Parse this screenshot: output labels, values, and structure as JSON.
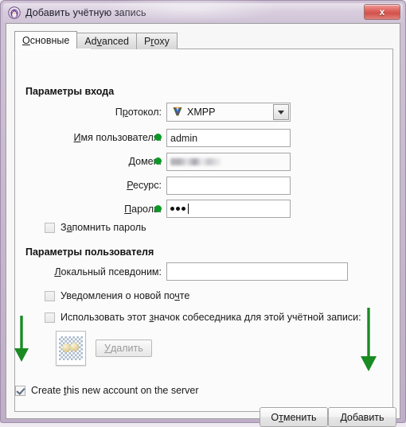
{
  "window": {
    "title": "Добавить учётную запись",
    "icon": "penguin-app-icon",
    "close_label": "x",
    "titlebar_color": "#c7b6cf",
    "close_color": "#d2524c"
  },
  "tabs": [
    {
      "id": "general",
      "label_pre": "",
      "label_mnemonic": "О",
      "label_post": "сновные",
      "active": true
    },
    {
      "id": "advanced",
      "label_pre": "Ad",
      "label_mnemonic": "v",
      "label_post": "anced",
      "active": false
    },
    {
      "id": "proxy",
      "label_pre": "P",
      "label_mnemonic": "r",
      "label_post": "oxy",
      "active": false
    }
  ],
  "login_group": {
    "title": "Параметры входа",
    "protocol": {
      "label_pre": "П",
      "label_mnemonic": "р",
      "label_post": "отокол:",
      "value": "XMPP",
      "icon": "xmpp-logo-icon"
    },
    "username": {
      "label_pre": "",
      "label_mnemonic": "И",
      "label_post": "мя пользователя:",
      "value": "admin",
      "required": true
    },
    "domain": {
      "label_pre": "",
      "label_mnemonic": "Д",
      "label_post": "омен:",
      "value": "",
      "redacted": true,
      "required": true
    },
    "resource": {
      "label_pre": "",
      "label_mnemonic": "Р",
      "label_post": "есурс:",
      "value": "",
      "required": false
    },
    "password": {
      "label_pre": "",
      "label_mnemonic": "П",
      "label_post": "ароль:",
      "value": "•••",
      "dot_count": 3,
      "required": true
    },
    "remember_password": {
      "label_pre": "З",
      "label_mnemonic": "а",
      "label_post": "помнить пароль",
      "checked": false
    }
  },
  "user_group": {
    "title": "Параметры пользователя",
    "nickname": {
      "label_pre": "",
      "label_mnemonic": "Л",
      "label_post": "окальный псевдоним:",
      "value": ""
    },
    "mail_notify": {
      "label_pre": "Уведомления о новой по",
      "label_mnemonic": "ч",
      "label_post": "те",
      "checked": false
    },
    "use_avatar": {
      "label_pre": "Использовать этот ",
      "label_mnemonic": "з",
      "label_post": "начок собеседника для этой учётной записи:",
      "checked": false
    },
    "avatar": {
      "icon": "avatar-thumbnail",
      "delete_pre": "",
      "delete_mnemonic": "У",
      "delete_post": "далить",
      "delete_enabled": false
    }
  },
  "footer": {
    "create_account": {
      "label_pre": "Create ",
      "label_mnemonic": "t",
      "label_post": "his new account on the server",
      "checked": true
    },
    "cancel": {
      "label_pre": "О",
      "label_mnemonic": "т",
      "label_post": "менить"
    },
    "submit": {
      "label_pre": "",
      "label_mnemonic": "Д",
      "label_post": "обавить"
    }
  },
  "annotations": {
    "arrow_color": "#1a8a23",
    "arrow_left": {
      "name": "arrow-to-create-account-checkbox"
    },
    "arrow_right": {
      "name": "arrow-to-add-button"
    }
  }
}
